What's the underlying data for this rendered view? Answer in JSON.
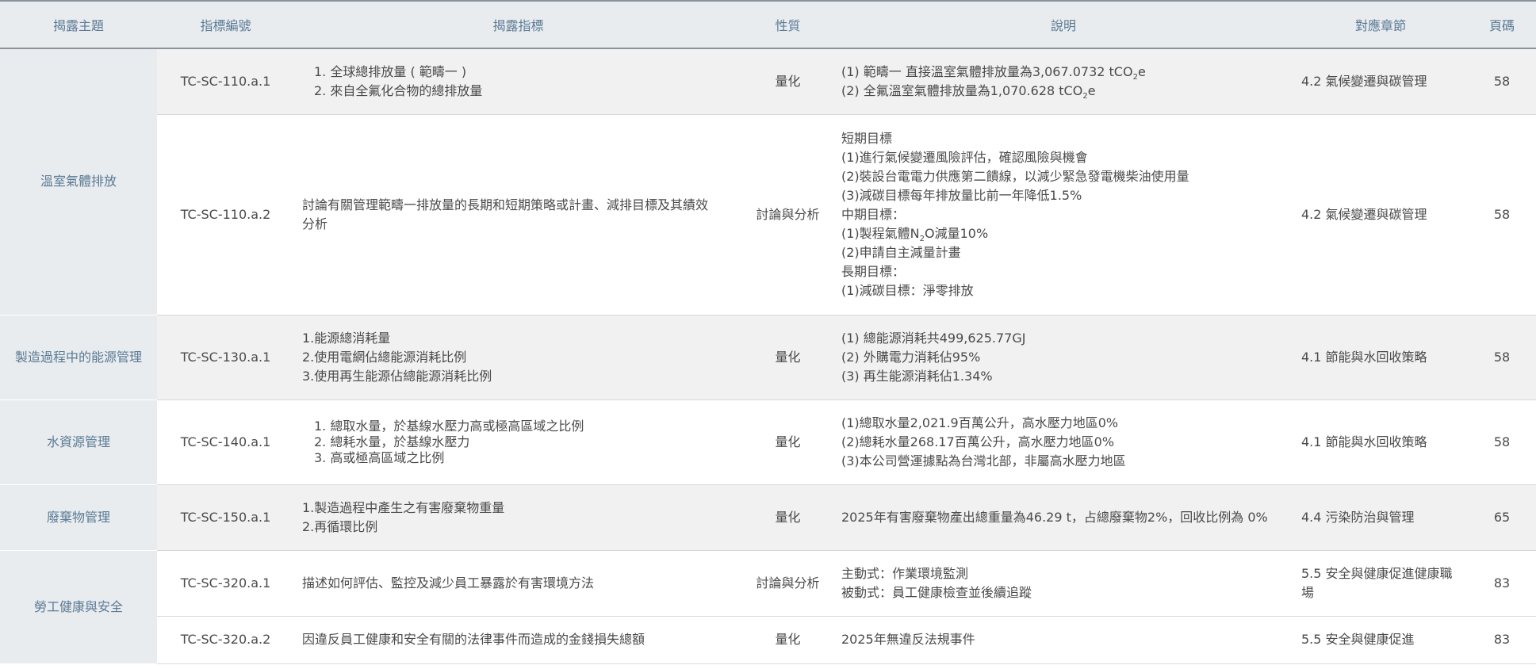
{
  "headers": [
    "揭露主題",
    "指標編號",
    "揭露指標",
    "性質",
    "說明",
    "對應章節",
    "頁碼"
  ],
  "rows": [
    {
      "topic": "溫室氣體排放",
      "code": "TC-SC-110.a.1",
      "metric": [
        "1. 全球總排放量 ( 範疇一 )",
        "2. 來自全氟化合物的總排放量"
      ],
      "nature": "量化",
      "desc": [
        {
          "pre": "(1) 範疇一 直接溫室氣體排放量為3,067.0732 tCO",
          "sub": "2",
          "post": "e"
        },
        {
          "pre": "(2) 全氟溫室氣體排放量為1,070.628 tCO",
          "sub": "2",
          "post": "e"
        }
      ],
      "chapter": "4.2 氣候變遷與碳管理",
      "page": "58"
    },
    {
      "code": "TC-SC-110.a.2",
      "metric": [
        "討論有關管理範疇一排放量的長期和短期策略或計畫、減排目標及其績效",
        "分析"
      ],
      "nature": "討論與分析",
      "desc": [
        {
          "pre": "短期目標"
        },
        {
          "pre": "(1)進行氣候變遷風險評估，確認風險與機會"
        },
        {
          "pre": "(2)裝設台電電力供應第二饋線，以減少緊急發電機柴油使用量"
        },
        {
          "pre": "(3)減碳目標每年排放量比前一年降低1.5%"
        },
        {
          "pre": "中期目標："
        },
        {
          "pre": "(1)製程氣體N",
          "sub": "2",
          "post": "O減量10%"
        },
        {
          "pre": "(2)申請自主減量計畫"
        },
        {
          "pre": "長期目標："
        },
        {
          "pre": " (1)減碳目標：淨零排放"
        }
      ],
      "chapter": "4.2 氣候變遷與碳管理",
      "page": "58"
    },
    {
      "topic": "製造過程中的能源管理",
      "code": "TC-SC-130.a.1",
      "metric": [
        "1.能源總消耗量",
        "2.使用電網佔總能源消耗比例",
        "3.使用再生能源佔總能源消耗比例"
      ],
      "nature": "量化",
      "desc": [
        {
          "pre": "(1) 總能源消耗共499,625.77GJ"
        },
        {
          "pre": "(2) 外購電力消耗佔95%"
        },
        {
          "pre": "(3) 再生能源消耗佔1.34%"
        }
      ],
      "chapter": "4.1 節能與水回收策略",
      "page": "58"
    },
    {
      "topic": "水資源管理",
      "code": "TC-SC-140.a.1",
      "metric": [
        "1. 總取水量，於基線水壓力高或極高區域之比例",
        "2. 總耗水量，於基線水壓力",
        "3. 高或極高區域之比例"
      ],
      "nature": "量化",
      "desc": [
        {
          "pre": "(1)總取水量2,021.9百萬公升，高水壓力地區0%"
        },
        {
          "pre": "(2)總耗水量268.17百萬公升，高水壓力地區0%"
        },
        {
          "pre": "(3)本公司營運據點為台灣北部，非屬高水壓力地區"
        }
      ],
      "chapter": "4.1 節能與水回收策略",
      "page": "58"
    },
    {
      "topic": "廢棄物管理",
      "code": "TC-SC-150.a.1",
      "metric": [
        "1.製造過程中產生之有害廢棄物重量",
        "2.再循環比例"
      ],
      "nature": "量化",
      "desc": [
        {
          "pre": "2025年有害廢棄物產出總重量為46.29 t，占總廢棄物2%，回收比例為 0%"
        }
      ],
      "chapter": "4.4 污染防治與管理",
      "page": "65"
    },
    {
      "topic": "勞工健康與安全",
      "code": "TC-SC-320.a.1",
      "metric": [
        "描述如何評估、監控及減少員工暴露於有害環境方法"
      ],
      "nature": "討論與分析",
      "desc": [
        {
          "pre": "主動式：作業環境監測"
        },
        {
          "pre": "被動式：員工健康檢查並後續追蹤"
        }
      ],
      "chapter": "5.5 安全與健康促進健康職場",
      "page": "83"
    },
    {
      "code": "TC-SC-320.a.2",
      "metric": [
        "因違反員工健康和安全有關的法律事件而造成的金錢損失總額"
      ],
      "nature": "量化",
      "desc": [
        {
          "pre": "2025年無違反法規事件"
        }
      ],
      "chapter": "5.5 安全與健康促進",
      "page": "83"
    }
  ]
}
